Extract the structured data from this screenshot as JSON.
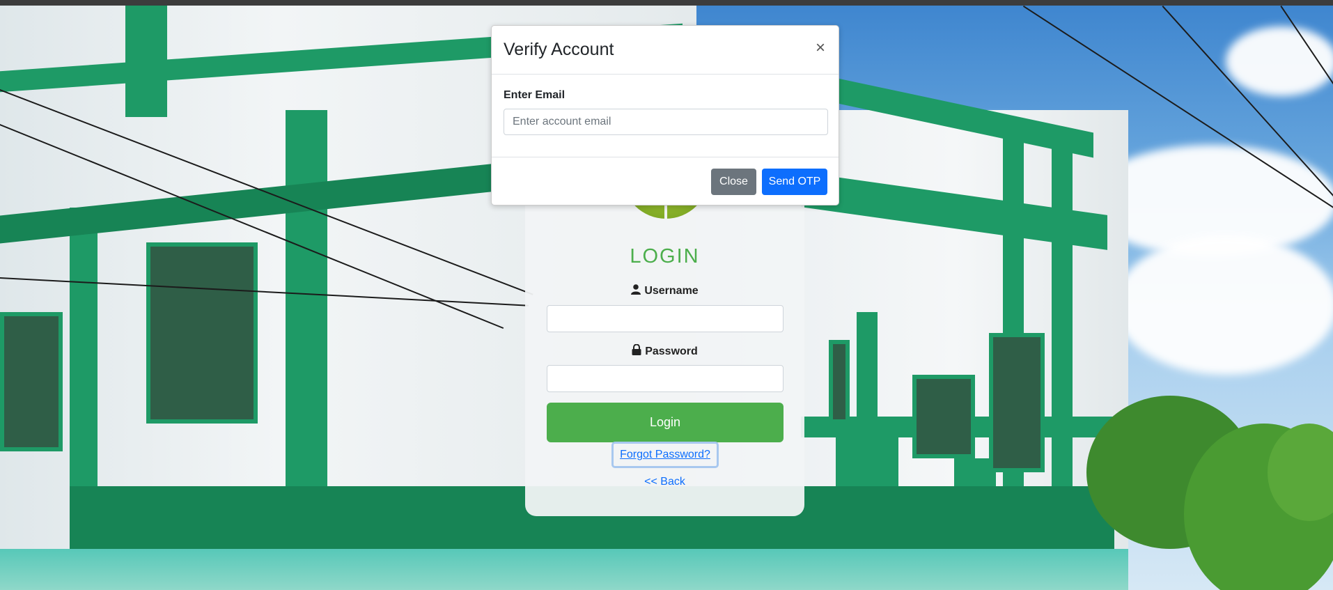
{
  "modal": {
    "title": "Verify Account",
    "close_x": "×",
    "email_label": "Enter Email",
    "email_placeholder": "Enter account email",
    "email_value": "",
    "close_button": "Close",
    "send_button": "Send OTP"
  },
  "login": {
    "title": "LOGIN",
    "username_label": "Username",
    "password_label": "Password",
    "login_button": "Login",
    "forgot_link": "Forgot Password?",
    "back_link": "<< Back"
  },
  "icons": {
    "username": "user-icon",
    "password": "lock-icon"
  },
  "colors": {
    "login_green": "#4cae4c",
    "primary_blue": "#0d6efd",
    "secondary_gray": "#6c757d"
  }
}
